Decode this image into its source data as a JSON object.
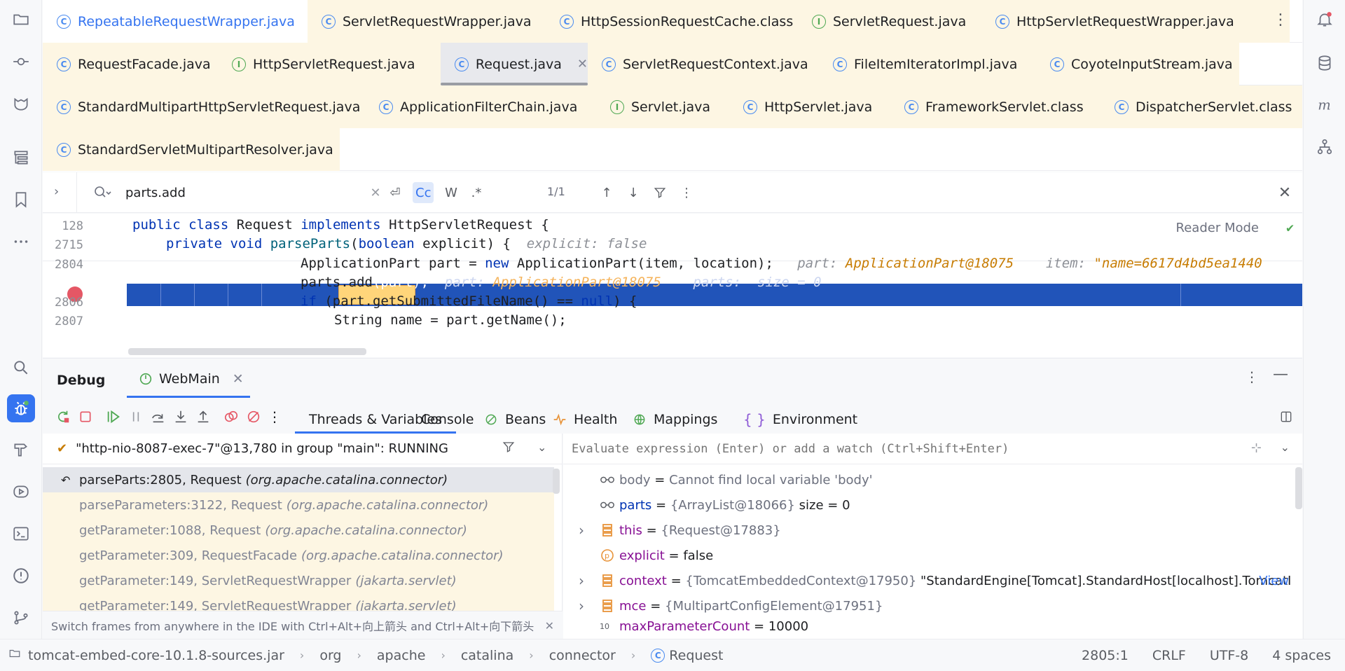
{
  "tabs": {
    "row1": [
      {
        "label": "RepeatableRequestWrapper.java",
        "type": "C",
        "link": true
      },
      {
        "label": "ServletRequestWrapper.java",
        "type": "C"
      },
      {
        "label": "HttpSessionRequestCache.class",
        "type": "C"
      },
      {
        "label": "ServletRequest.java",
        "type": "I"
      },
      {
        "label": "HttpServletRequestWrapper.java",
        "type": "C"
      }
    ],
    "row2": [
      {
        "label": "RequestFacade.java",
        "type": "C"
      },
      {
        "label": "HttpServletRequest.java",
        "type": "I"
      },
      {
        "label": "Request.java",
        "type": "C",
        "active": true
      },
      {
        "label": "ServletRequestContext.java",
        "type": "C"
      },
      {
        "label": "FileItemIteratorImpl.java",
        "type": "C"
      },
      {
        "label": "CoyoteInputStream.java",
        "type": "C"
      }
    ],
    "row3": [
      {
        "label": "StandardMultipartHttpServletRequest.java",
        "type": "C"
      },
      {
        "label": "ApplicationFilterChain.java",
        "type": "C"
      },
      {
        "label": "Servlet.java",
        "type": "I"
      },
      {
        "label": "HttpServlet.java",
        "type": "C"
      },
      {
        "label": "FrameworkServlet.class",
        "type": "C"
      },
      {
        "label": "DispatcherServlet.class",
        "type": "C"
      }
    ],
    "row4": [
      {
        "label": "StandardServletMultipartResolver.java",
        "type": "C"
      }
    ],
    "more": "⋮"
  },
  "search": {
    "query": "parts.add",
    "match_count": "1/1",
    "case_label": "Cc",
    "words_label": "W",
    "regex_label": ".*"
  },
  "editor": {
    "reader_mode": "Reader Mode",
    "lines": [
      {
        "num": "128",
        "indent": 0,
        "tokens": [
          [
            "kw",
            "public "
          ],
          [
            "kw",
            "class "
          ],
          [
            "",
            "Request "
          ],
          [
            "kw",
            "implements "
          ],
          [
            "",
            "HttpServletRequest {"
          ]
        ]
      },
      {
        "num": "2715",
        "indent": 1,
        "tokens": [
          [
            "kw",
            "private "
          ],
          [
            "kw",
            "void "
          ],
          [
            "fn",
            "parseParts"
          ],
          [
            "",
            "("
          ],
          [
            "kw",
            "boolean "
          ],
          [
            "",
            "explicit) {"
          ],
          [
            "hint",
            "  explicit: "
          ],
          [
            "hint",
            "false"
          ]
        ]
      },
      {
        "num": "2804",
        "indent": 5,
        "tokens": [
          [
            "",
            "ApplicationPart part = "
          ],
          [
            "kw",
            "new "
          ],
          [
            "",
            "ApplicationPart(item, location);"
          ],
          [
            "hint",
            "   part: "
          ],
          [
            "hval",
            "ApplicationPart@18075"
          ],
          [
            "hint",
            "    item: "
          ],
          [
            "hstr",
            "\"name=6617d4bd5ea1440"
          ]
        ]
      },
      {
        "num": "",
        "indent": 5,
        "exec": true,
        "tokens": [
          [
            "mark",
            "parts.add"
          ],
          [
            "",
            "(part);"
          ],
          [
            "hint",
            "  part: "
          ],
          [
            "hval",
            "ApplicationPart@18075"
          ],
          [
            "hint",
            "    parts:  size = 0"
          ]
        ]
      },
      {
        "num": "2806",
        "indent": 5,
        "tokens": [
          [
            "kw",
            "if "
          ],
          [
            "",
            "(part.getSubmittedFileName() == "
          ],
          [
            "kw",
            "null"
          ],
          [
            "",
            ") {"
          ]
        ]
      },
      {
        "num": "2807",
        "indent": 6,
        "tokens": [
          [
            "",
            "String name = part.getName();"
          ]
        ]
      }
    ]
  },
  "debug": {
    "title": "Debug",
    "session_tab": "WebMain",
    "view_tabs": [
      "Threads & Variables",
      "Console",
      "Beans",
      "Health",
      "Mappings",
      "Environment"
    ],
    "thread": "\"http-nio-8087-exec-7\"@13,780 in group \"main\": RUNNING",
    "frames": [
      {
        "method": "parseParts:2805, Request",
        "pkg": "(org.apache.catalina.connector)",
        "selected": true
      },
      {
        "method": "parseParameters:3122, Request",
        "pkg": "(org.apache.catalina.connector)"
      },
      {
        "method": "getParameter:1088, Request",
        "pkg": "(org.apache.catalina.connector)"
      },
      {
        "method": "getParameter:309, RequestFacade",
        "pkg": "(org.apache.catalina.connector)"
      },
      {
        "method": "getParameter:149, ServletRequestWrapper",
        "pkg": "(jakarta.servlet)"
      },
      {
        "method": "getParameter:149, ServletRequestWrapper",
        "pkg": "(jakarta.servlet)"
      }
    ],
    "frames_tip": "Switch frames from anywhere in the IDE with Ctrl+Alt+向上箭头 and Ctrl+Alt+向下箭头",
    "eval_placeholder": "Evaluate expression (Enter) or add a watch (Ctrl+Shift+Enter)",
    "vars": [
      {
        "icon": "watch",
        "name": "body",
        "eq": " = ",
        "value": "Cannot find local variable 'body'",
        "watch": true
      },
      {
        "icon": "watch",
        "name": "parts",
        "eq": " = ",
        "value": "{ArrayList@18066}",
        "extra": "  size = 0",
        "watch": true
      },
      {
        "icon": "field",
        "name": "this",
        "eq": " = ",
        "value": "{Request@17883}",
        "expandable": true
      },
      {
        "icon": "param",
        "name": "explicit",
        "eq": " = ",
        "value": "false"
      },
      {
        "icon": "field",
        "name": "context",
        "eq": " = ",
        "value": "{TomcatEmbeddedContext@17950}",
        "extra": " \"StandardEngine[Tomcat].StandardHost[localhost].TomcatI...",
        "link": "View",
        "expandable": true
      },
      {
        "icon": "field",
        "name": "mce",
        "eq": " = ",
        "value": "{MultipartConfigElement@17951}",
        "expandable": true
      },
      {
        "icon": "int",
        "name": "maxParameterCount",
        "eq": " = ",
        "value": "10000"
      }
    ]
  },
  "status": {
    "crumbs": [
      "tomcat-embed-core-10.1.8-sources.jar",
      "org",
      "apache",
      "catalina",
      "connector",
      "Request"
    ],
    "position": "2805:1",
    "line_sep": "CRLF",
    "encoding": "UTF-8",
    "indent": "4 spaces"
  },
  "colors": {
    "accent": "#3574f0",
    "exec_line": "#2154b9",
    "breakpoint": "#e55765"
  }
}
